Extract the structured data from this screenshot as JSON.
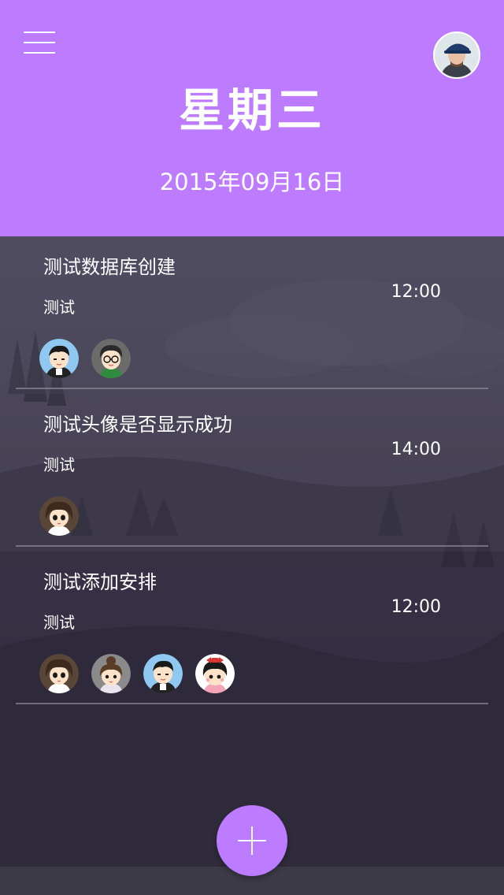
{
  "header": {
    "weekday": "星期三",
    "date": "2015年09月16日",
    "menu_icon": "menu-icon",
    "user_avatar": "user-avatar"
  },
  "schedules": [
    {
      "title": "测试数据库创建",
      "subtitle": "测试",
      "time": "12:00",
      "participants": [
        "boy-blue",
        "boy-glasses"
      ]
    },
    {
      "title": "测试头像是否显示成功",
      "subtitle": "测试",
      "time": "14:00",
      "participants": [
        "girl-brown"
      ]
    },
    {
      "title": "测试添加安排",
      "subtitle": "测试",
      "time": "12:00",
      "participants": [
        "girl-brown",
        "girl-bun",
        "boy-blue",
        "girl-bow"
      ]
    }
  ],
  "fab": {
    "icon": "plus-icon"
  },
  "colors": {
    "accent": "#bd7bff",
    "text": "#ffffff",
    "background": "#35303f"
  }
}
